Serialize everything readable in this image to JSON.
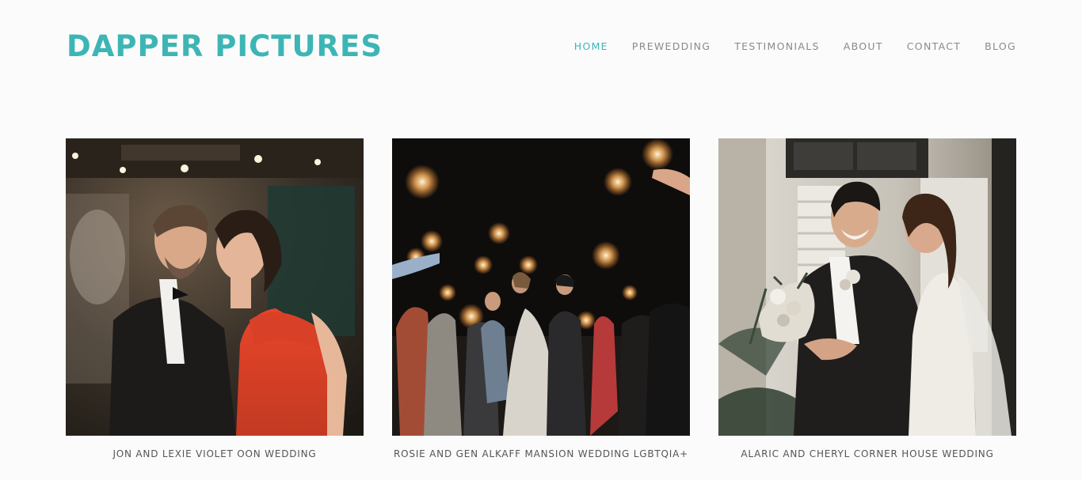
{
  "header": {
    "logo_text": "DAPPER PICTURES",
    "logo_color": "#3db5b5"
  },
  "nav": {
    "active_color": "#3db5b5",
    "items": [
      {
        "label": "HOME",
        "active": true
      },
      {
        "label": "PREWEDDING",
        "active": false
      },
      {
        "label": "TESTIMONIALS",
        "active": false
      },
      {
        "label": "ABOUT",
        "active": false
      },
      {
        "label": "CONTACT",
        "active": false
      },
      {
        "label": "BLOG",
        "active": false
      }
    ]
  },
  "gallery": {
    "items": [
      {
        "caption": "JON AND LEXIE VIOLET OON WEDDING"
      },
      {
        "caption": "ROSIE AND GEN ALKAFF MANSION WEDDING LGBTQIA+"
      },
      {
        "caption": "ALARIC AND CHERYL CORNER HOUSE WEDDING"
      }
    ]
  }
}
